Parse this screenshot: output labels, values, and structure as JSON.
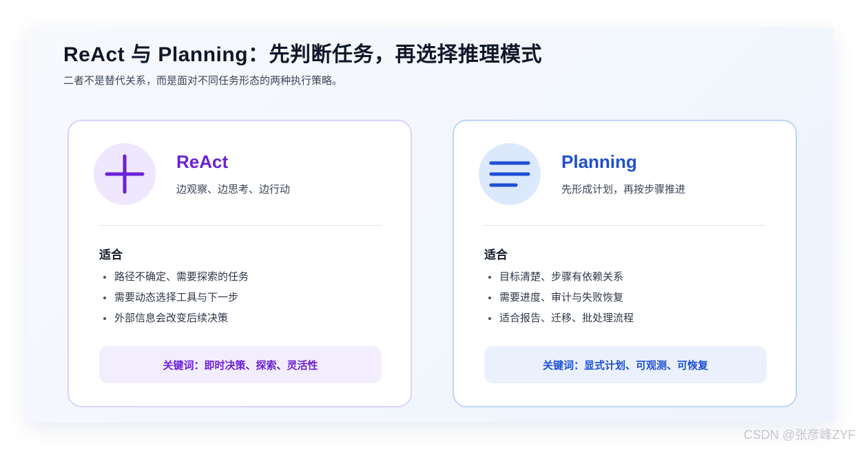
{
  "header": {
    "title": "ReAct 与 Planning：先判断任务，再选择推理模式",
    "subtitle": "二者不是替代关系，而是面对不同任务形态的两种执行策略。"
  },
  "cards": [
    {
      "icon": "plus-icon",
      "accent_color": "#6b21d6",
      "title": "ReAct",
      "desc": "边观察、边思考、边行动",
      "section_label": "适合",
      "bullets": [
        "路径不确定、需要探索的任务",
        "需要动态选择工具与下一步",
        "外部信息会改变后续决策"
      ],
      "keywords": "关键词：即时决策、探索、灵活性"
    },
    {
      "icon": "menu-lines-icon",
      "accent_color": "#1f4fd1",
      "title": "Planning",
      "desc": "先形成计划，再按步骤推进",
      "section_label": "适合",
      "bullets": [
        "目标清楚、步骤有依赖关系",
        "需要进度、审计与失败恢复",
        "适合报告、迁移、批处理流程"
      ],
      "keywords": "关键词：显式计划、可观测、可恢复"
    }
  ],
  "watermark": "CSDN @张彦峰ZYF"
}
